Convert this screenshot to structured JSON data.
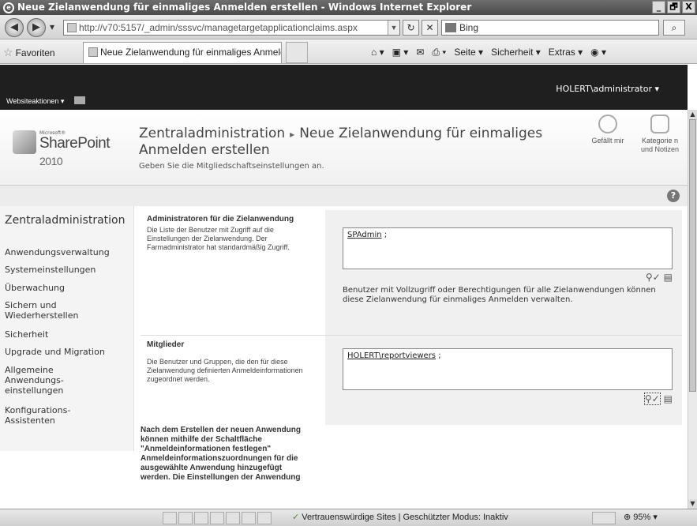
{
  "window": {
    "title": "Neue Zielanwendung für einmaliges Anmelden erstellen - Windows Internet Explorer",
    "controls": [
      "_",
      "🗗",
      "X"
    ]
  },
  "address": {
    "url": "http://v70:5157/_admin/sssvc/managetargetapplicationclaims.aspx",
    "search_text": "Bing"
  },
  "favorites": {
    "label": "Favoriten",
    "tab_title": "Neue Zielanwendung für einmaliges Anmelden erstellen",
    "commands": [
      "Seite ▾",
      "Sicherheit ▾",
      "Extras ▾"
    ]
  },
  "ribbon": {
    "site_actions": "Websiteaktionen ▾",
    "user": "HOLERT\\administrator ▾"
  },
  "logo": {
    "microsoft": "Microsoft®",
    "name": "SharePoint",
    "version": "2010"
  },
  "title_area": {
    "crumb_root": "Zentraladministration",
    "separator": "▸",
    "page_title": "Neue Zielanwendung für einmaliges Anmelden erstellen",
    "description": "Geben Sie die Mitgliedschaftseinstellungen an.",
    "like_label": "Gefällt mir",
    "tags_label": "Kategorie n und Notizen"
  },
  "nav": {
    "heading": "Zentraladministration",
    "items": [
      "Anwendungsverwaltung",
      "Systemeinstellungen",
      "Überwachung",
      "Sichern und Wiederherstellen",
      "Sicherheit",
      "Upgrade und Migration",
      "Allgemeine Anwendungs- einstellungen",
      "Konfigurations- Assistenten"
    ]
  },
  "admins": {
    "heading": "Administratoren für die Zielanwendung",
    "description": "Die Liste der Benutzer mit Zugriff auf die Einstellungen der Zielanwendung. Der Farmadministrator hat standardmäßig Zugriff.",
    "value": "SPAdmin",
    "value_suffix": " ;",
    "note": "Benutzer mit Vollzugriff oder Berechtigungen für alle Zielanwendungen können diese Zielanwendung für einmaliges Anmelden verwalten."
  },
  "members": {
    "heading": "Mitglieder",
    "description": "Die Benutzer und Gruppen, die den für diese Zielanwendung definierten Anmeldeinformationen zugeordnet werden.",
    "value": "HOLERT\\reportviewers",
    "value_suffix": " ;"
  },
  "bottom_note": "Nach dem Erstellen der neuen Anwendung können mithilfe der Schaltfläche \"Anmeldeinformationen festlegen\" Anmeldeinformationszuordnungen für die ausgewählte Anwendung hinzugefügt werden. Die Einstellungen der Anwendung",
  "status": {
    "zone": "Vertrauenswürdige Sites | Geschützter Modus: Inaktiv",
    "zoom": "95%"
  }
}
